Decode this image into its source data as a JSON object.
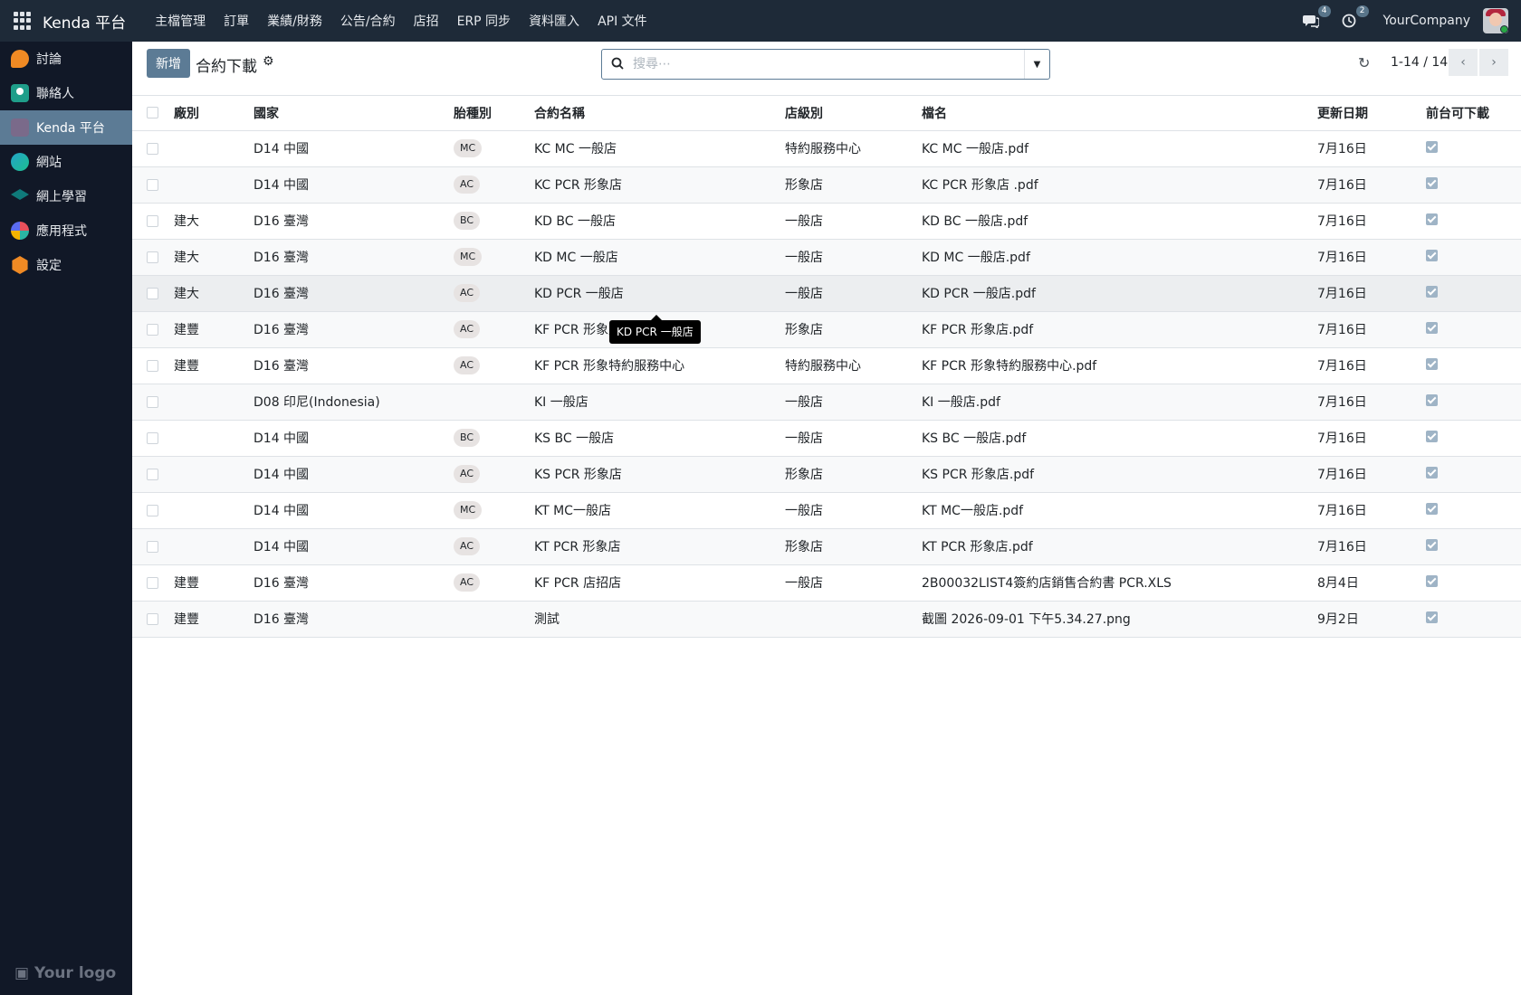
{
  "header": {
    "brand": "Kenda 平台",
    "menu": [
      "主檔管理",
      "訂單",
      "業績/財務",
      "公告/合約",
      "店招",
      "ERP 同步",
      "資料匯入",
      "API 文件"
    ],
    "messages_count": "4",
    "activities_count": "2",
    "company": "YourCompany"
  },
  "sidebar": {
    "items": [
      {
        "label": "討論",
        "icon": "discuss-icon"
      },
      {
        "label": "聯絡人",
        "icon": "contacts-icon"
      },
      {
        "label": "Kenda 平台",
        "icon": "kenda-icon",
        "active": true
      },
      {
        "label": "網站",
        "icon": "website-icon"
      },
      {
        "label": "網上學習",
        "icon": "elearning-icon"
      },
      {
        "label": "應用程式",
        "icon": "apps-icon"
      },
      {
        "label": "設定",
        "icon": "settings-icon"
      }
    ],
    "logo": "Your logo"
  },
  "control": {
    "new_label": "新增",
    "title": "合約下載",
    "search_placeholder": "搜尋⋯",
    "pager": "1-14 / 14"
  },
  "table": {
    "columns": [
      "廠別",
      "國家",
      "胎種別",
      "合約名稱",
      "店級別",
      "檔名",
      "更新日期",
      "前台可下載"
    ],
    "rows": [
      {
        "factory": "",
        "country": "D14 中國",
        "tire": "MC",
        "contract": "KC MC 一般店",
        "level": "特約服務中心",
        "file": "KC MC 一般店.pdf",
        "date": "7月16日",
        "download": true
      },
      {
        "factory": "",
        "country": "D14 中國",
        "tire": "AC",
        "contract": "KC PCR 形象店",
        "level": "形象店",
        "file": "KC PCR 形象店 .pdf",
        "date": "7月16日",
        "download": true
      },
      {
        "factory": "建大",
        "country": "D16 臺灣",
        "tire": "BC",
        "contract": "KD BC 一般店",
        "level": "一般店",
        "file": "KD BC 一般店.pdf",
        "date": "7月16日",
        "download": true
      },
      {
        "factory": "建大",
        "country": "D16 臺灣",
        "tire": "MC",
        "contract": "KD MC 一般店",
        "level": "一般店",
        "file": "KD MC 一般店.pdf",
        "date": "7月16日",
        "download": true
      },
      {
        "factory": "建大",
        "country": "D16 臺灣",
        "tire": "AC",
        "contract": "KD PCR 一般店",
        "level": "一般店",
        "file": "KD PCR 一般店.pdf",
        "date": "7月16日",
        "download": true
      },
      {
        "factory": "建豐",
        "country": "D16 臺灣",
        "tire": "AC",
        "contract": "KF PCR 形象店",
        "level": "形象店",
        "file": "KF PCR 形象店.pdf",
        "date": "7月16日",
        "download": true
      },
      {
        "factory": "建豐",
        "country": "D16 臺灣",
        "tire": "AC",
        "contract": "KF PCR 形象特約服務中心",
        "level": "特約服務中心",
        "file": "KF PCR 形象特約服務中心.pdf",
        "date": "7月16日",
        "download": true
      },
      {
        "factory": "",
        "country": "D08 印尼(Indonesia)",
        "tire": "",
        "contract": "KI 一般店",
        "level": "一般店",
        "file": "KI 一般店.pdf",
        "date": "7月16日",
        "download": true
      },
      {
        "factory": "",
        "country": "D14 中國",
        "tire": "BC",
        "contract": "KS BC 一般店",
        "level": "一般店",
        "file": "KS BC 一般店.pdf",
        "date": "7月16日",
        "download": true
      },
      {
        "factory": "",
        "country": "D14 中國",
        "tire": "AC",
        "contract": "KS PCR 形象店",
        "level": "形象店",
        "file": "KS PCR 形象店.pdf",
        "date": "7月16日",
        "download": true
      },
      {
        "factory": "",
        "country": "D14 中國",
        "tire": "MC",
        "contract": "KT MC一般店",
        "level": "一般店",
        "file": "KT MC一般店.pdf",
        "date": "7月16日",
        "download": true
      },
      {
        "factory": "",
        "country": "D14 中國",
        "tire": "AC",
        "contract": "KT PCR 形象店",
        "level": "形象店",
        "file": "KT PCR 形象店.pdf",
        "date": "7月16日",
        "download": true
      },
      {
        "factory": "建豐",
        "country": "D16 臺灣",
        "tire": "AC",
        "contract": "KF PCR 店招店",
        "level": "一般店",
        "file": "2B00032LIST4簽約店銷售合約書 PCR.XLS",
        "date": "8月4日",
        "download": true
      },
      {
        "factory": "建豐",
        "country": "D16 臺灣",
        "tire": "",
        "contract": "測試",
        "level": "",
        "file": "截圖 2026-09-01 下午5.34.27.png",
        "date": "9月2日",
        "download": true
      }
    ]
  },
  "tooltip": "KD PCR 一般店",
  "colors": {
    "navbar": "#1e2a38",
    "sidebar": "#111827",
    "accent": "#5c7b95"
  }
}
